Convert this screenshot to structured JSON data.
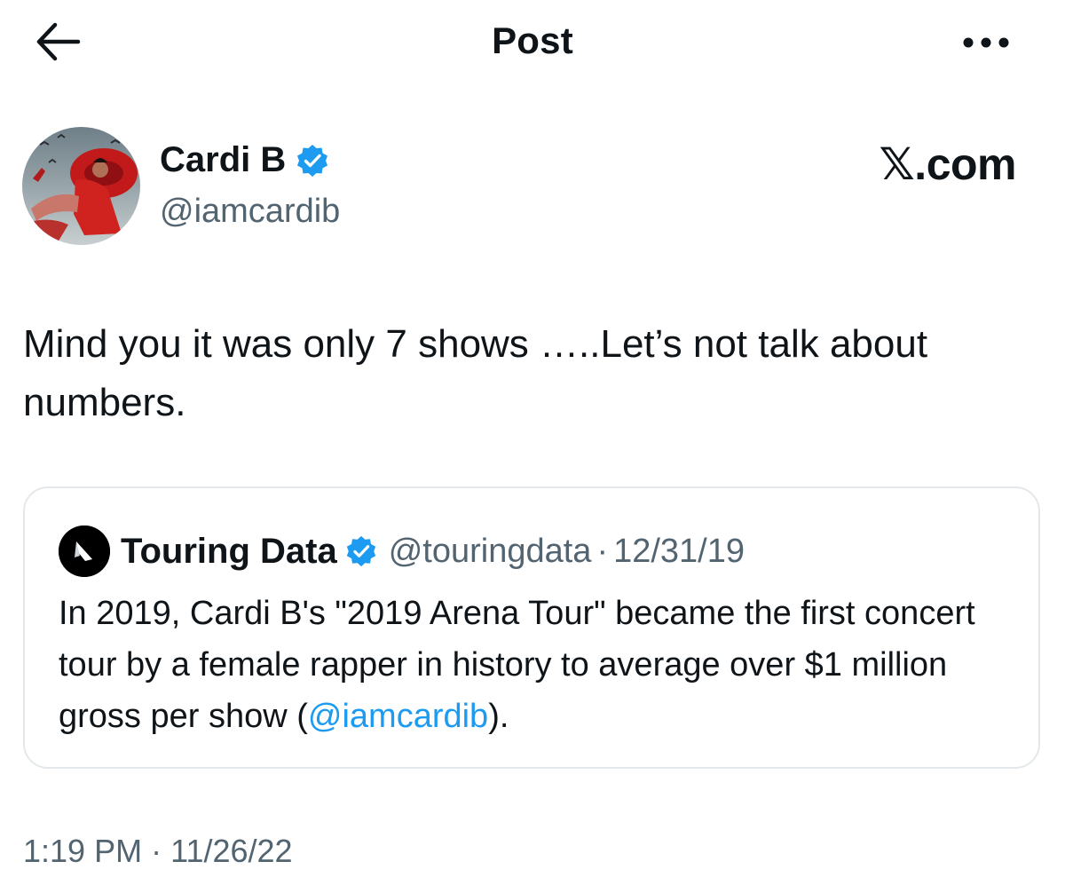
{
  "header": {
    "title": "Post",
    "back_icon": "arrow-left-icon",
    "more_icon": "more-horizontal-icon"
  },
  "author": {
    "display_name": "Cardi B",
    "handle": "@iamcardib",
    "verified": true
  },
  "watermark": "𝕏.com",
  "post": {
    "text": "Mind you it was only 7 shows …..Let’s not talk about numbers."
  },
  "quote": {
    "display_name": "Touring Data",
    "handle": "@touringdata",
    "separator": "·",
    "date": "12/31/19",
    "text_before": "In 2019, Cardi B's \"2019 Arena Tour\" became the first concert tour by a female rapper in history to average over $1 million gross per show (",
    "mention": "@iamcardib",
    "text_after": ")."
  },
  "timestamp": {
    "time": "1:19 PM",
    "separator": "·",
    "date": "11/26/22"
  },
  "colors": {
    "text": "#0f1419",
    "secondary": "#536471",
    "link": "#1d9bf0",
    "verified": "#1d9bf0",
    "border": "#e4e8eb"
  }
}
